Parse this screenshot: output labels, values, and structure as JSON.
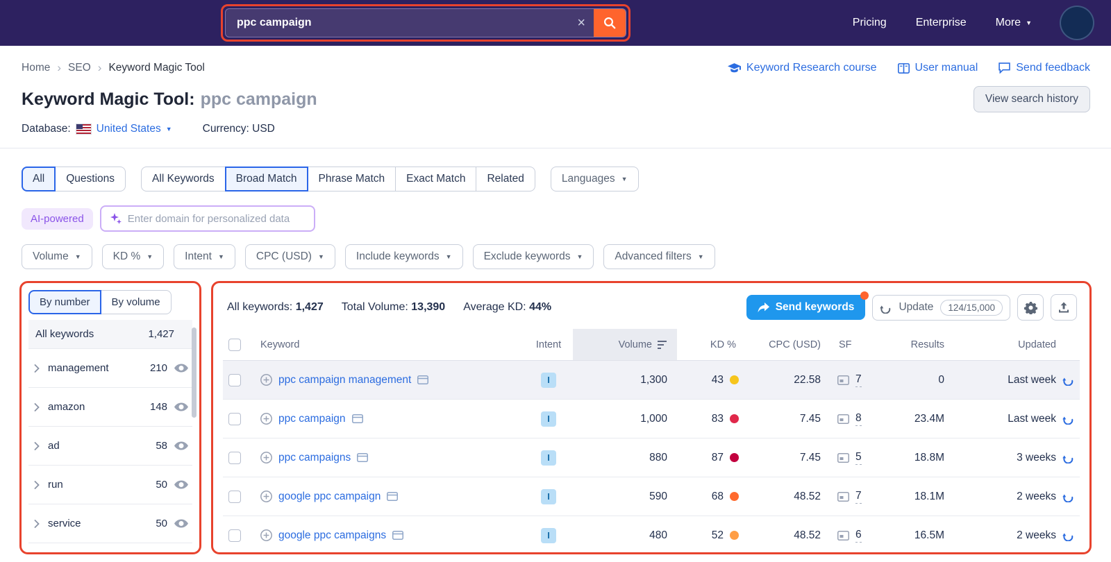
{
  "colors": {
    "highlight_red": "#e8432d",
    "brand_orange": "#ff642d",
    "link_blue": "#2b6ce0",
    "send_blue": "#1f97ed"
  },
  "topbar": {
    "search_value": "ppc campaign",
    "nav": [
      {
        "label": "Pricing"
      },
      {
        "label": "Enterprise"
      },
      {
        "label": "More"
      }
    ]
  },
  "breadcrumb": {
    "items": [
      "Home",
      "SEO",
      "Keyword Magic Tool"
    ]
  },
  "help_links": [
    {
      "label": "Keyword Research course"
    },
    {
      "label": "User manual"
    },
    {
      "label": "Send feedback"
    }
  ],
  "page": {
    "title": "Keyword Magic Tool:",
    "query": "ppc campaign",
    "history_button": "View search history",
    "database_label": "Database:",
    "database_value": "United States",
    "currency_text": "Currency: USD"
  },
  "match_tabs": {
    "group1": [
      "All",
      "Questions"
    ],
    "group1_selected": "All",
    "group2": [
      "All Keywords",
      "Broad Match",
      "Phrase Match",
      "Exact Match",
      "Related"
    ],
    "group2_selected": "Broad Match",
    "languages": "Languages"
  },
  "ai": {
    "badge": "AI-powered",
    "placeholder": "Enter domain for personalized data"
  },
  "filters": [
    "Volume",
    "KD %",
    "Intent",
    "CPC (USD)",
    "Include keywords",
    "Exclude keywords",
    "Advanced filters"
  ],
  "sidebar": {
    "tabs": [
      "By number",
      "By volume"
    ],
    "selected_tab": "By number",
    "all_label": "All keywords",
    "all_count": "1,427",
    "groups": [
      {
        "name": "management",
        "count": "210"
      },
      {
        "name": "amazon",
        "count": "148"
      },
      {
        "name": "ad",
        "count": "58"
      },
      {
        "name": "run",
        "count": "50"
      },
      {
        "name": "service",
        "count": "50"
      }
    ]
  },
  "summary": {
    "all_keywords_label": "All keywords:",
    "all_keywords": "1,427",
    "total_volume_label": "Total Volume:",
    "total_volume": "13,390",
    "avg_kd_label": "Average KD:",
    "avg_kd": "44%"
  },
  "actions": {
    "send": "Send keywords",
    "update": "Update",
    "quota": "124/15,000"
  },
  "table": {
    "headers": {
      "keyword": "Keyword",
      "intent": "Intent",
      "volume": "Volume",
      "kd": "KD %",
      "cpc": "CPC (USD)",
      "sf": "SF",
      "results": "Results",
      "updated": "Updated"
    },
    "rows": [
      {
        "keyword": "ppc campaign management",
        "intent": "I",
        "volume": "1,300",
        "kd": "43",
        "kd_color": "#f6c51d",
        "cpc": "22.58",
        "sf": "7",
        "results": "0",
        "updated": "Last week"
      },
      {
        "keyword": "ppc campaign",
        "intent": "I",
        "volume": "1,000",
        "kd": "83",
        "kd_color": "#e0284a",
        "cpc": "7.45",
        "sf": "8",
        "results": "23.4M",
        "updated": "Last week"
      },
      {
        "keyword": "ppc campaigns",
        "intent": "I",
        "volume": "880",
        "kd": "87",
        "kd_color": "#c2003e",
        "cpc": "7.45",
        "sf": "5",
        "results": "18.8M",
        "updated": "3 weeks"
      },
      {
        "keyword": "google ppc campaign",
        "intent": "I",
        "volume": "590",
        "kd": "68",
        "kd_color": "#ff6a2e",
        "cpc": "48.52",
        "sf": "7",
        "results": "18.1M",
        "updated": "2 weeks"
      },
      {
        "keyword": "google ppc campaigns",
        "intent": "I",
        "volume": "480",
        "kd": "52",
        "kd_color": "#ff9e46",
        "cpc": "48.52",
        "sf": "6",
        "results": "16.5M",
        "updated": "2 weeks"
      }
    ]
  }
}
